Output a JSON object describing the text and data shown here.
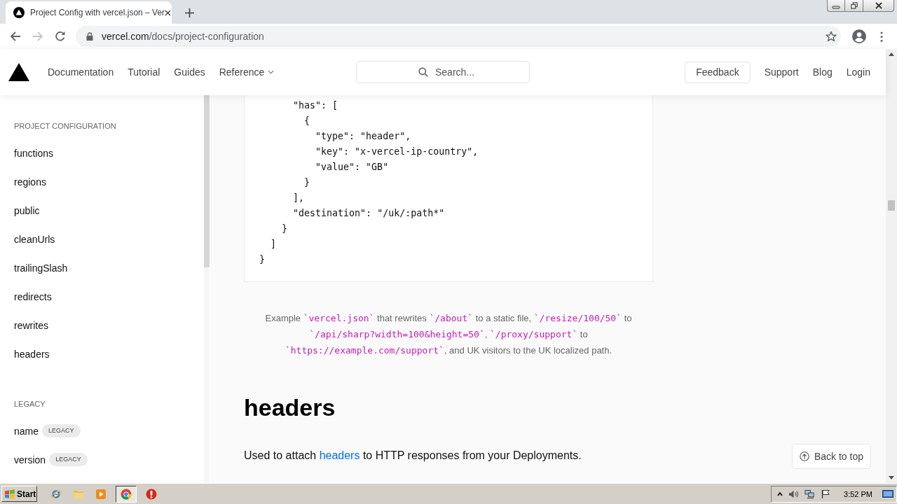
{
  "browser": {
    "tabs": [
      {
        "title": "Project Config with vercel.json – Ver",
        "selected": true
      }
    ],
    "nav_buttons": [
      {
        "kind": "back",
        "disabled": false
      },
      {
        "kind": "forward",
        "disabled": true
      },
      {
        "kind": "reload",
        "disabled": false
      }
    ],
    "url": {
      "host": "vercel.com",
      "path": "/docs/project-configuration"
    }
  },
  "site_nav": {
    "links": [
      {
        "label": "Documentation",
        "kind": "link"
      },
      {
        "label": "Tutorial",
        "kind": "link"
      },
      {
        "label": "Guides",
        "kind": "link"
      },
      {
        "label": "Reference",
        "kind": "dropdown"
      }
    ],
    "search": {
      "placeholder": "Search..."
    },
    "feedback": "Feedback",
    "right_links": [
      "Support",
      "Blog",
      "Login"
    ]
  },
  "sidebar": {
    "sections": [
      {
        "heading": "PROJECT CONFIGURATION",
        "items": [
          {
            "label": "functions"
          },
          {
            "label": "regions"
          },
          {
            "label": "public"
          },
          {
            "label": "cleanUrls"
          },
          {
            "label": "trailingSlash"
          },
          {
            "label": "redirects"
          },
          {
            "label": "rewrites"
          },
          {
            "label": "headers"
          }
        ]
      },
      {
        "heading": "LEGACY",
        "items": [
          {
            "label": "name",
            "badge": "LEGACY"
          },
          {
            "label": "version",
            "badge": "LEGACY"
          }
        ]
      }
    ]
  },
  "content": {
    "code_lines": [
      "      \"has\": [",
      "        {",
      "          \"type\": \"header\",",
      "          \"key\": \"x-vercel-ip-country\",",
      "          \"value\": \"GB\"",
      "        }",
      "      ],",
      "      \"destination\": \"/uk/:path*\"",
      "    }",
      "  ]",
      "}"
    ],
    "caption": [
      {
        "kind": "text",
        "text": "Example "
      },
      {
        "kind": "code",
        "text": "`vercel.json`"
      },
      {
        "kind": "text",
        "text": " that rewrites "
      },
      {
        "kind": "code",
        "text": "`/about`"
      },
      {
        "kind": "text",
        "text": " to a static file, "
      },
      {
        "kind": "code",
        "text": "`/resize/100/50`"
      },
      {
        "kind": "text",
        "text": " to "
      },
      {
        "kind": "code",
        "text": "`/api/sharp?width=100&height=50`"
      },
      {
        "kind": "text",
        "text": ", "
      },
      {
        "kind": "code",
        "text": "`/proxy/support`"
      },
      {
        "kind": "text",
        "text": " to "
      },
      {
        "kind": "code",
        "text": "`https://example.com/support`"
      },
      {
        "kind": "text",
        "text": ", and UK visitors to the UK localized path."
      }
    ],
    "heading": "headers",
    "paragraphs": [
      [
        {
          "kind": "text",
          "text": "Used to attach "
        },
        {
          "kind": "link",
          "text": "headers"
        },
        {
          "kind": "text",
          "text": " to HTTP responses from your Deployments."
        }
      ]
    ]
  },
  "back_to_top": {
    "label": "Back to top"
  },
  "taskbar": {
    "start": "Start",
    "apps": [
      {
        "kind": "web",
        "selected": false
      },
      {
        "kind": "folder",
        "selected": false
      },
      {
        "kind": "media",
        "selected": false
      },
      {
        "kind": "browser",
        "selected": true
      },
      {
        "kind": "alert",
        "selected": false
      }
    ],
    "clock": "3:52 PM"
  }
}
